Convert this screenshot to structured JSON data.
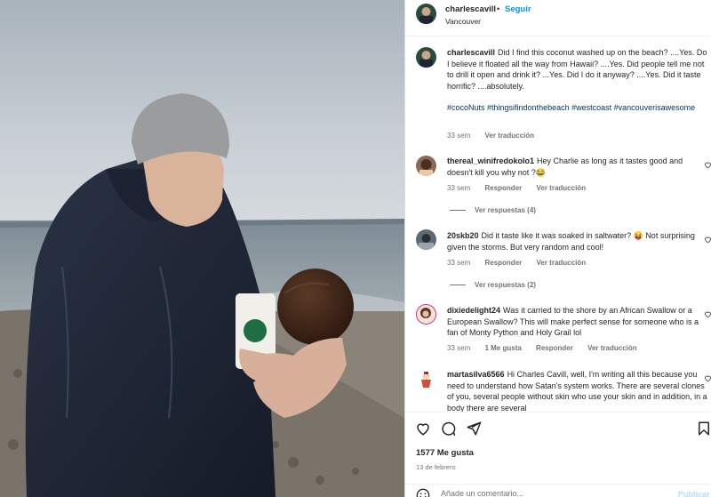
{
  "header": {
    "username": "charlescavill",
    "separator": "•",
    "follow_label": "Seguir",
    "location": "Vancouver"
  },
  "caption": {
    "username": "charlescavill",
    "text": "Did I find this coconut washed up on the beach? ....Yes. Do I believe it floated all the way from Hawaii? ....Yes. Did people tell me not to drill it open and drink it? ...Yes. Did I do it anyway? ....Yes. Did it taste horrific? ....absolutely.",
    "hashtags": "#cocoNuts #thingsifindonthebeach #westcoast #vancouverisawesome",
    "age": "33 sem",
    "translate": "Ver traducción"
  },
  "comments": [
    {
      "username": "thereal_winifredokolo1",
      "text": "Hey Charlie as long as it tastes good and doesn't kill you why not ?😂",
      "age": "33 sem",
      "reply": "Responder",
      "translate": "Ver traducción",
      "replies": "Ver respuestas (4)"
    },
    {
      "username": "20skb20",
      "text": "Did it taste like it was soaked in saltwater? 😝 Not surprising given the storms. But very random and cool!",
      "age": "33 sem",
      "reply": "Responder",
      "translate": "Ver traducción",
      "replies": "Ver respuestas (2)"
    },
    {
      "username": "dixiedelight24",
      "text": "Was it carried to the shore by an African Swallow or a European Swallow? This will make perfect sense for someone who is a fan of Monty Python and Holy Grail lol",
      "age": "33 sem",
      "likes": "1 Me gusta",
      "reply": "Responder",
      "translate": "Ver traducción"
    },
    {
      "username": "martasilva6566",
      "text": "Hi Charles Cavill, well, I'm writing all this because you need to understand how Satan's system works. There are several clones of you, several people without skin who use your skin and in addition, in a body there are several"
    }
  ],
  "footer": {
    "likes": "1577 Me gusta",
    "date": "13 de febrero",
    "comment_placeholder": "Añade un comentario...",
    "publish_label": "Publicar"
  },
  "icons": [
    "heart-icon",
    "comment-icon",
    "share-icon",
    "bookmark-icon",
    "emoji-icon"
  ],
  "colors": {
    "link": "#0095f6",
    "hashtag": "#00376b",
    "muted": "#737373"
  }
}
